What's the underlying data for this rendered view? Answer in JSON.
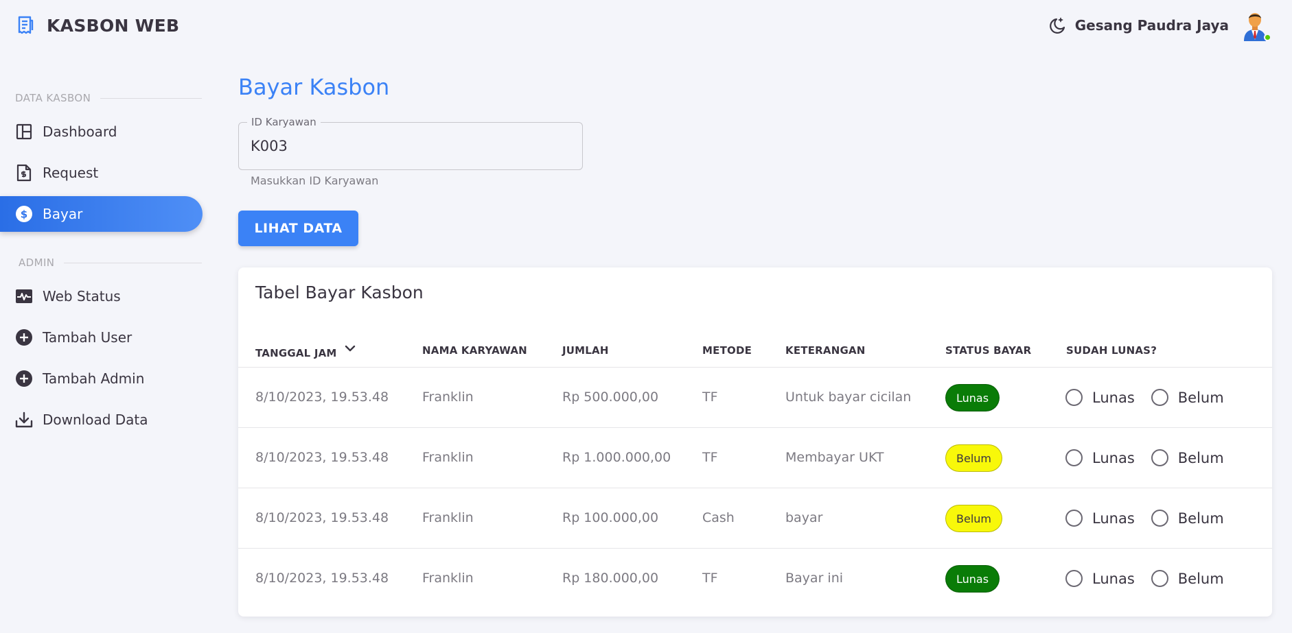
{
  "header": {
    "brand_title": "KASBON WEB",
    "user_name": "Gesang Paudra Jaya",
    "online_color": "#56ca00"
  },
  "sidebar": {
    "sections": [
      {
        "label": "DATA KASBON"
      },
      {
        "label": "ADMIN"
      }
    ],
    "items": [
      {
        "label": "Dashboard",
        "icon": "dashboard-icon"
      },
      {
        "label": "Request",
        "icon": "invoice-icon"
      },
      {
        "label": "Bayar",
        "icon": "dollar-icon",
        "active": true
      },
      {
        "label": "Web Status",
        "icon": "pulse-icon"
      },
      {
        "label": "Tambah User",
        "icon": "plus-circle-icon"
      },
      {
        "label": "Tambah Admin",
        "icon": "plus-circle-icon"
      },
      {
        "label": "Download Data",
        "icon": "download-icon"
      }
    ],
    "accent": "#3b82f6"
  },
  "main": {
    "title": "Bayar Kasbon",
    "id_field": {
      "label": "ID Karyawan",
      "value": "K003",
      "helper": "Masukkan ID Karyawan"
    },
    "view_button": "LIHAT DATA"
  },
  "table": {
    "title": "Tabel Bayar Kasbon",
    "columns": [
      "TANGGAL JAM",
      "NAMA KARYAWAN",
      "JUMLAH",
      "METODE",
      "KETERANGAN",
      "STATUS BAYAR",
      "SUDAH LUNAS?"
    ],
    "radio_options": [
      "Lunas",
      "Belum"
    ],
    "rows": [
      {
        "tanggal": "8/10/2023, 19.53.48",
        "nama": "Franklin",
        "jumlah": "Rp 500.000,00",
        "metode": "TF",
        "keterangan": "Untuk bayar cicilan",
        "status": "Lunas"
      },
      {
        "tanggal": "8/10/2023, 19.53.48",
        "nama": "Franklin",
        "jumlah": "Rp 1.000.000,00",
        "metode": "TF",
        "keterangan": "Membayar UKT",
        "status": "Belum"
      },
      {
        "tanggal": "8/10/2023, 19.53.48",
        "nama": "Franklin",
        "jumlah": "Rp 100.000,00",
        "metode": "Cash",
        "keterangan": "bayar",
        "status": "Belum"
      },
      {
        "tanggal": "8/10/2023, 19.53.48",
        "nama": "Franklin",
        "jumlah": "Rp 180.000,00",
        "metode": "TF",
        "keterangan": "Bayar ini",
        "status": "Lunas"
      }
    ],
    "status_colors": {
      "Lunas": "#0a7c07",
      "Belum": "#f8f80a"
    }
  }
}
